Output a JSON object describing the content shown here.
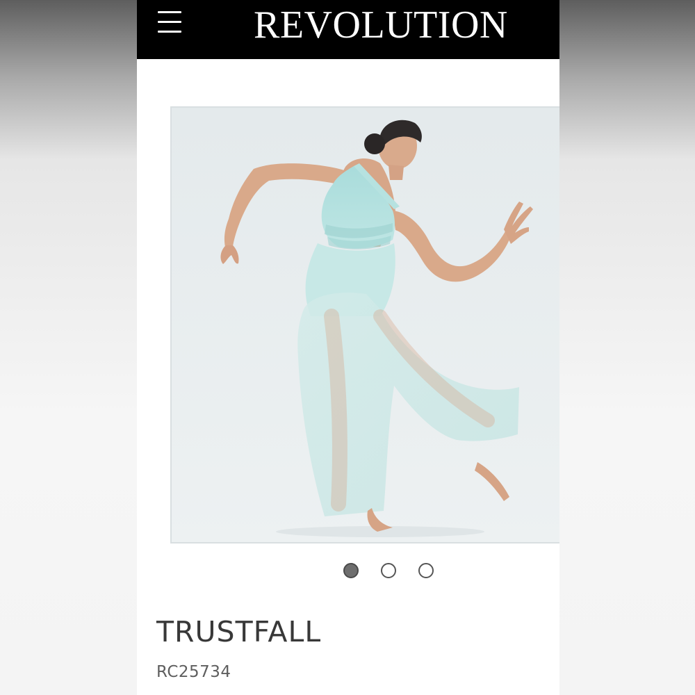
{
  "header": {
    "brand": "REVOLUTION",
    "menu_icon": "hamburger-menu-icon",
    "background_color": "#000000",
    "text_color": "#ffffff"
  },
  "gallery": {
    "image_description_icon": "product-photo",
    "background_color": "#e6ecee",
    "garment_color": "#bfe6e4",
    "slides_total": 3,
    "active_slide": 1
  },
  "product": {
    "name": "TRUSTFALL",
    "sku": "RC25734"
  },
  "colors": {
    "page_background": "#ffffff",
    "dot_active": "#6e6e6e",
    "title_text": "#383838",
    "sku_text": "#5e5e5e"
  }
}
